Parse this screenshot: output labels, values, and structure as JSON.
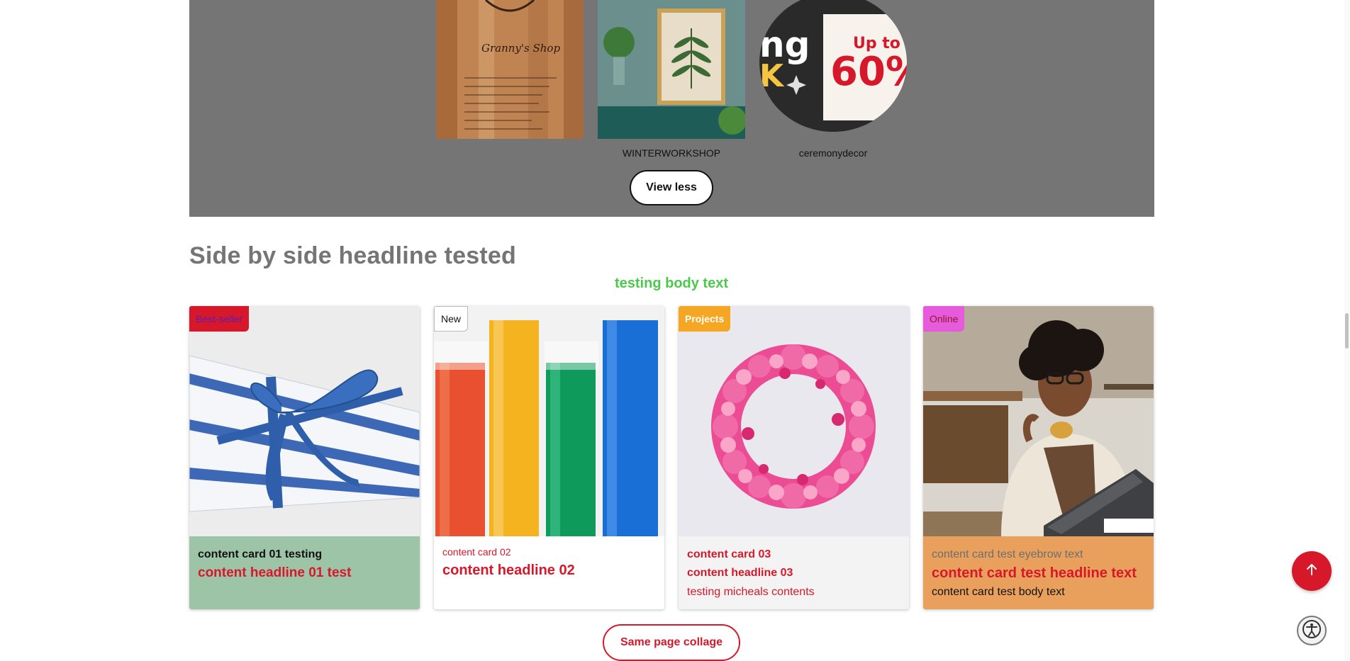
{
  "shop_strip": {
    "tiles": [
      {
        "label": "",
        "image_text": "Granny's Shop"
      },
      {
        "label": "WINTERWORKSHOP"
      },
      {
        "label": "ceremonydecor",
        "image_text_a": "Up to",
        "image_text_b": "60%",
        "image_text_c": "ng",
        "image_text_d": "K"
      }
    ],
    "view_less_label": "View less"
  },
  "section": {
    "title": "Side by side headline tested",
    "body": "testing body text"
  },
  "cards": [
    {
      "badge": "Best-seller",
      "badge_bg": "#d7182a",
      "badge_color": "#5b1fb3",
      "eyebrow": "content card 01 testing",
      "headline": "content headline 01 test",
      "body": ""
    },
    {
      "badge": "New",
      "badge_bg": "#ffffff",
      "badge_color": "#111111",
      "eyebrow": "content card 02",
      "headline": "content headline 02",
      "body": ""
    },
    {
      "badge": "Projects",
      "badge_bg": "#f5a623",
      "badge_color": "#ffffff",
      "eyebrow": "content card 03",
      "headline": "content headline 03",
      "body": "testing micheals contents"
    },
    {
      "badge": "Online",
      "badge_bg": "#e85adc",
      "badge_color": "#8b1a2a",
      "eyebrow": "content card test eyebrow text",
      "headline": "content card test headline text",
      "body": "content card test body text"
    }
  ],
  "same_page_label": "Same page collage",
  "colors": {
    "accent_red": "#d7182a",
    "shop_band": "#757575",
    "body_green": "#4cc94c"
  },
  "icons": {
    "scroll_top": "arrow-up-icon",
    "accessibility": "accessibility-icon"
  }
}
